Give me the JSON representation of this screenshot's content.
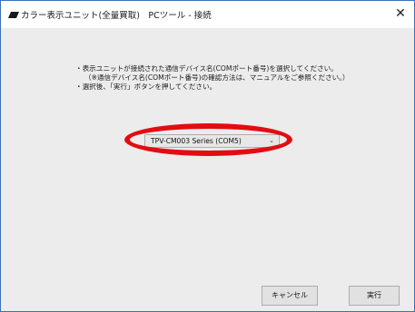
{
  "window": {
    "title": "カラー表示ユニット(全量買取)　PCツール - 接続",
    "close_glyph": "✕"
  },
  "instructions": {
    "line1": "・表示ユニットが接続された通信デバイス名(COMポート番号)を選択してください。",
    "line2": "（※通信デバイス名(COMポート番号)の確認方法は、マニュアルをご参照ください。）",
    "line3": "・選択後、「実行」ボタンを押してください。"
  },
  "port_select": {
    "value": "TPV-CM003 Series (COM5)",
    "chevron": "⌄"
  },
  "buttons": {
    "cancel": "キャンセル",
    "run": "実行"
  },
  "colors": {
    "highlight": "#e10d12",
    "client_bg": "#ececec",
    "window_border": "#3d6fb8"
  }
}
